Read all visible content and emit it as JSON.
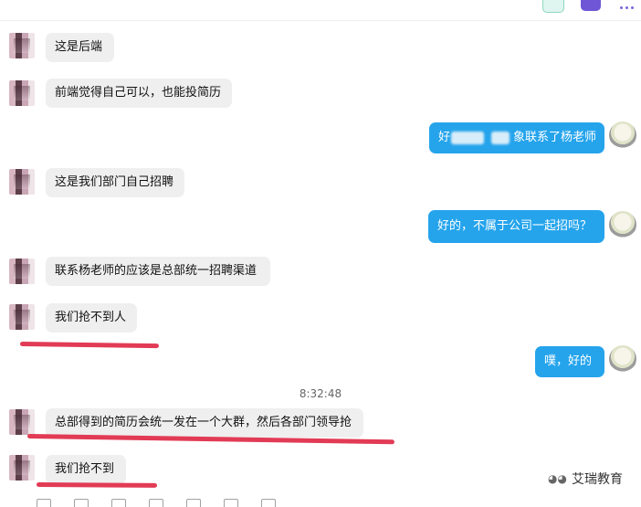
{
  "header": {
    "icons": [
      "phone-icon",
      "video-icon",
      "more-icon"
    ]
  },
  "messages": [
    {
      "side": "left",
      "text": "这是后端"
    },
    {
      "side": "left",
      "text": "前端觉得自己可以，也能投简历"
    },
    {
      "side": "right",
      "text_start": "好",
      "text_end": "象联系了杨老师"
    },
    {
      "side": "left",
      "text": "这是我们部门自己招聘"
    },
    {
      "side": "right",
      "text": "好的，不属于公司一起招吗？"
    },
    {
      "side": "left",
      "text": "联系杨老师的应该是总部统一招聘渠道"
    },
    {
      "side": "left",
      "text": "我们抢不到人"
    },
    {
      "side": "right",
      "text": "噗，好的"
    },
    {
      "side": "left",
      "text": "总部得到的简历会统一发在一个大群，然后各部门领导抢"
    },
    {
      "side": "left",
      "text": "我们抢不到"
    }
  ],
  "timestamp": "8:32:48",
  "watermark": {
    "icon": "wechat-icon",
    "text": "艾瑞教育"
  },
  "colors": {
    "right_bubble": "#25a4ec",
    "left_bubble": "#efefef",
    "underline": "#e23b55"
  }
}
